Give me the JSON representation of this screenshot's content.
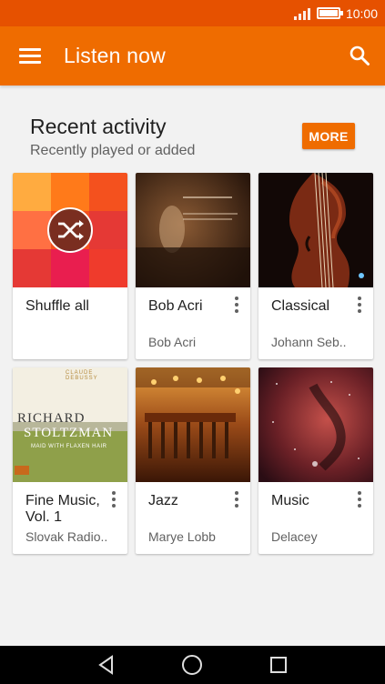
{
  "status_bar": {
    "time": "10:00",
    "icons": [
      "signal-icon",
      "battery-icon"
    ]
  },
  "app_bar": {
    "title": "Listen now",
    "icons": [
      "menu-icon",
      "search-icon"
    ]
  },
  "recent": {
    "title": "Recent activity",
    "subtitle": "Recently played or added",
    "more_label": "MORE"
  },
  "cards": [
    {
      "title": "Shuffle all",
      "subtitle": "",
      "has_menu": false,
      "icon": "shuffle-icon"
    },
    {
      "title": "Bob Acri",
      "subtitle": "Bob Acri",
      "has_menu": true
    },
    {
      "title": "Classical",
      "subtitle": "Johann Seb..",
      "has_menu": true
    },
    {
      "title": "Fine Music, Vol. 1",
      "subtitle": "Slovak Radio..",
      "has_menu": true,
      "art_text": {
        "top": "CLAUDE DEBUSSY",
        "name1": "RICHARD",
        "name2": "STOLTZMAN",
        "album": "MAID WITH FLAXEN HAIR"
      }
    },
    {
      "title": "Jazz",
      "subtitle": "Marye Lobb",
      "has_menu": true
    },
    {
      "title": "Music",
      "subtitle": "Delacey",
      "has_menu": true
    }
  ],
  "nav_bar": {
    "icons": [
      "back-icon",
      "home-icon",
      "recents-icon"
    ]
  },
  "colors": {
    "status_bar": "#e65100",
    "app_bar": "#ef6c00",
    "accent": "#ef6c00",
    "background": "#f2f2f2"
  }
}
